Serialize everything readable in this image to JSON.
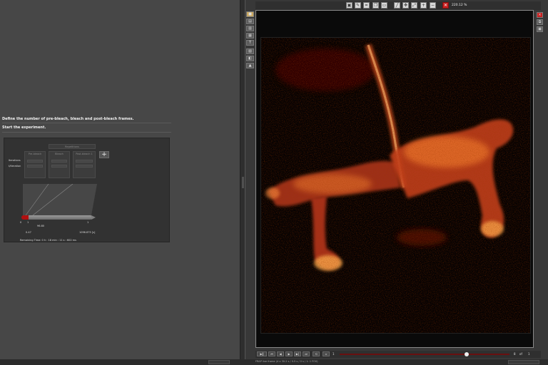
{
  "left_panel": {
    "instruction_1": "Define the number of pre-bleach, bleach and post-bleach frames.",
    "instruction_2": "Start the experiment."
  },
  "frap_widget": {
    "repetitions_label": "Repetitions",
    "phases": [
      "Pre-bleach",
      "Bleach",
      "Post-bleach 1"
    ],
    "row_labels": [
      "Iterations",
      "t/iteration"
    ],
    "add_phase_icon": "plus-icon",
    "timeline": {
      "tick_labels": [
        "0",
        "1",
        "96.80"
      ],
      "value_labels": [
        "0.47",
        "1096.875 [s]"
      ],
      "end_tick": "1"
    },
    "remaining_time": "Remaining Time: 0 h : 18 min : 11 s : 602 ms"
  },
  "viewer": {
    "zoom_label": "220.12 %",
    "toolbar_icons": [
      "select-icon",
      "pan-icon",
      "crop-icon",
      "copy-icon",
      "region-icon",
      "ruler-icon",
      "move-icon",
      "fit-icon",
      "zoom-in-icon",
      "zoom-out-icon",
      "zoom-reset-icon"
    ],
    "left_tools": [
      "color-icon",
      "channel-icon",
      "overlay-icon",
      "settings-icon",
      "info-icon",
      "histogram-icon",
      "lut-icon",
      "scale-icon"
    ],
    "right_tools": [
      "close-icon",
      "detach-icon",
      "snapshot-icon"
    ],
    "playback": {
      "frame_start": "1",
      "frame_current": "8",
      "frame_of": "of",
      "frame_total": "1"
    },
    "status_text": "FRAP live frame (4 x 30.2 s / 0.5 s / 0 s / 1: 1 FOV)",
    "colors": {
      "lut_dark": "#3a0000",
      "lut_mid": "#c83010",
      "lut_bright": "#ffc050",
      "accent_red": "#c82020"
    }
  }
}
